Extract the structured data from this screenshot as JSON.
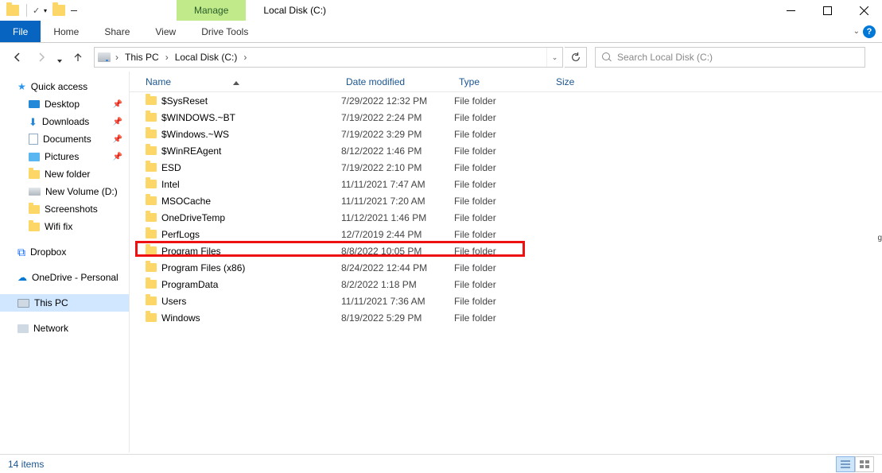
{
  "title": "Local Disk (C:)",
  "manage_label": "Manage",
  "ribbon": {
    "file": "File",
    "home": "Home",
    "share": "Share",
    "view": "View",
    "drive_tools": "Drive Tools"
  },
  "breadcrumb": {
    "root_arrow": "›",
    "this_pc": "This PC",
    "sep": "›",
    "local_disk": "Local Disk (C:)"
  },
  "search": {
    "placeholder": "Search Local Disk (C:)"
  },
  "sidebar": {
    "quick_access": "Quick access",
    "desktop": "Desktop",
    "downloads": "Downloads",
    "documents": "Documents",
    "pictures": "Pictures",
    "new_folder": "New folder",
    "new_volume": "New Volume (D:)",
    "screenshots": "Screenshots",
    "wifi_fix": "Wifi fix",
    "dropbox": "Dropbox",
    "onedrive": "OneDrive - Personal",
    "this_pc": "This PC",
    "network": "Network"
  },
  "columns": {
    "name": "Name",
    "date": "Date modified",
    "type": "Type",
    "size": "Size"
  },
  "files": [
    {
      "name": "$SysReset",
      "date": "7/29/2022 12:32 PM",
      "type": "File folder"
    },
    {
      "name": "$WINDOWS.~BT",
      "date": "7/19/2022 2:24 PM",
      "type": "File folder"
    },
    {
      "name": "$Windows.~WS",
      "date": "7/19/2022 3:29 PM",
      "type": "File folder"
    },
    {
      "name": "$WinREAgent",
      "date": "8/12/2022 1:46 PM",
      "type": "File folder"
    },
    {
      "name": "ESD",
      "date": "7/19/2022 2:10 PM",
      "type": "File folder"
    },
    {
      "name": "Intel",
      "date": "11/11/2021 7:47 AM",
      "type": "File folder"
    },
    {
      "name": "MSOCache",
      "date": "11/11/2021 7:20 AM",
      "type": "File folder"
    },
    {
      "name": "OneDriveTemp",
      "date": "11/12/2021 1:46 PM",
      "type": "File folder"
    },
    {
      "name": "PerfLogs",
      "date": "12/7/2019 2:44 PM",
      "type": "File folder"
    },
    {
      "name": "Program Files",
      "date": "8/8/2022 10:05 PM",
      "type": "File folder"
    },
    {
      "name": "Program Files (x86)",
      "date": "8/24/2022 12:44 PM",
      "type": "File folder"
    },
    {
      "name": "ProgramData",
      "date": "8/2/2022 1:18 PM",
      "type": "File folder"
    },
    {
      "name": "Users",
      "date": "11/11/2021 7:36 AM",
      "type": "File folder"
    },
    {
      "name": "Windows",
      "date": "8/19/2022 5:29 PM",
      "type": "File folder"
    }
  ],
  "highlight_index": 9,
  "status": {
    "count": "14 items"
  }
}
